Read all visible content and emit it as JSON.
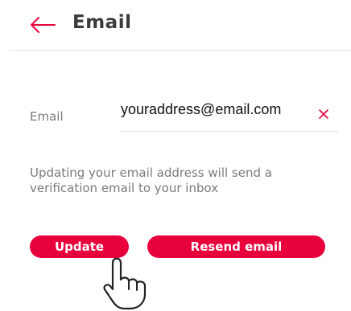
{
  "header": {
    "back_icon": "arrow-left-icon",
    "title": "Email"
  },
  "form": {
    "email_label": "Email",
    "email_value": "youraddress@email.com",
    "clear_icon": "close-icon"
  },
  "info": {
    "line1": "Updating your email address will send a",
    "line2": "verification email to your inbox"
  },
  "actions": {
    "update_label": "Update",
    "resend_label": "Resend email"
  },
  "overlay": {
    "pointer_icon": "hand-pointer-icon"
  },
  "colors": {
    "accent": "#e8003d",
    "text_dark": "#3b3b3b",
    "text_muted": "#7a7a7a"
  }
}
